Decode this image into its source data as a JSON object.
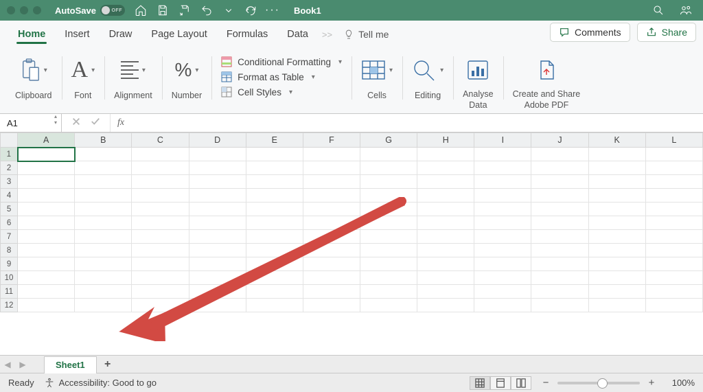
{
  "titlebar": {
    "autosave_label": "AutoSave",
    "autosave_state": "OFF",
    "document_title": "Book1"
  },
  "tabs": {
    "items": [
      "Home",
      "Insert",
      "Draw",
      "Page Layout",
      "Formulas",
      "Data"
    ],
    "active_index": 0,
    "tell_me": "Tell me",
    "comments": "Comments",
    "share": "Share"
  },
  "ribbon": {
    "clipboard": "Clipboard",
    "font": "Font",
    "alignment": "Alignment",
    "number": "Number",
    "styles": {
      "conditional": "Conditional Formatting",
      "table": "Format as Table",
      "cell": "Cell Styles"
    },
    "cells": "Cells",
    "editing": "Editing",
    "analyse": "Analyse\nData",
    "pdf": "Create and Share\nAdobe PDF"
  },
  "formula_bar": {
    "namebox": "A1",
    "fx": "fx",
    "value": ""
  },
  "grid": {
    "columns": [
      "A",
      "B",
      "C",
      "D",
      "E",
      "F",
      "G",
      "H",
      "I",
      "J",
      "K",
      "L"
    ],
    "rows": [
      1,
      2,
      3,
      4,
      5,
      6,
      7,
      8,
      9,
      10,
      11,
      12
    ],
    "active_cell": {
      "col": 0,
      "row": 0
    }
  },
  "sheets": {
    "active": "Sheet1"
  },
  "statusbar": {
    "ready": "Ready",
    "accessibility": "Accessibility: Good to go",
    "zoom": "100%"
  }
}
